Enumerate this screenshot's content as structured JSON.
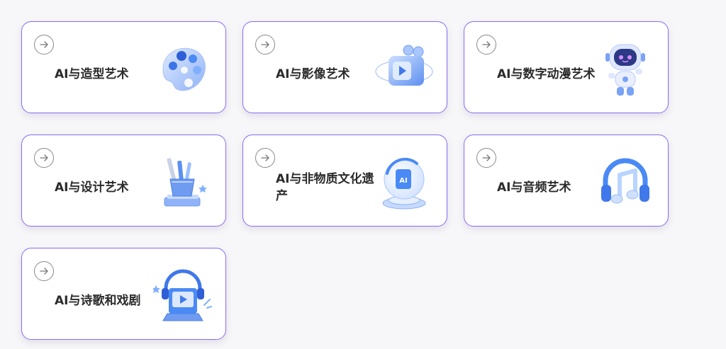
{
  "cards": [
    {
      "title": "AI与造型艺术",
      "icon": "palette-icon"
    },
    {
      "title": "AI与影像艺术",
      "icon": "video-play-icon"
    },
    {
      "title": "AI与数字动漫艺术",
      "icon": "robot-icon"
    },
    {
      "title": "AI与设计艺术",
      "icon": "pencil-cup-icon"
    },
    {
      "title": "AI与非物质文化遗产",
      "icon": "ai-globe-icon"
    },
    {
      "title": "AI与音频艺术",
      "icon": "headphones-music-icon"
    },
    {
      "title": "AI与诗歌和戏剧",
      "icon": "headphones-laptop-icon"
    }
  ],
  "colors": {
    "card_border": "#8b6cf0",
    "title_text": "#2b2b2b",
    "icon_blue": "#4a8af4",
    "icon_light": "#b9d4ff"
  }
}
